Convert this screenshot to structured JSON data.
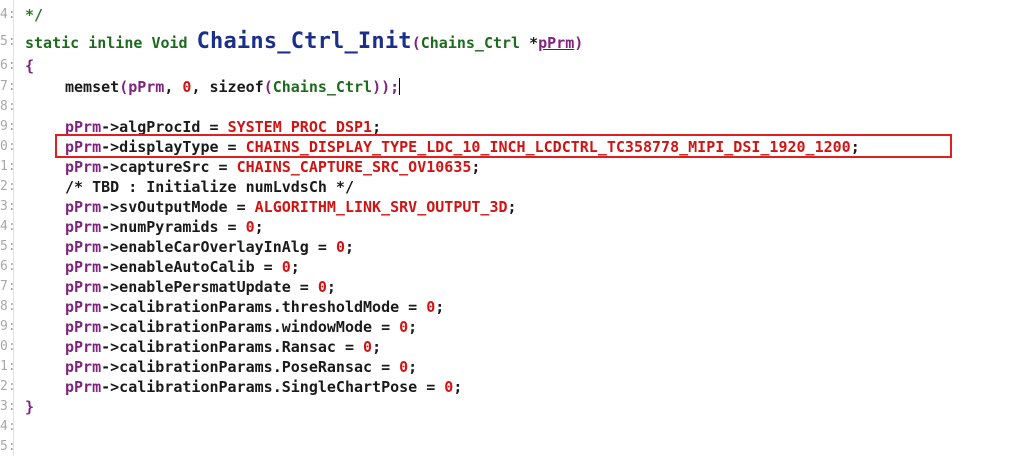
{
  "gutter": {
    "lines": [
      "4:",
      "5:",
      "6:",
      "7:",
      "8:",
      "9:",
      "0:",
      "1:",
      "2:",
      "3:",
      "4:",
      "5:",
      "6:",
      "7:",
      "8:",
      "9:",
      "0:",
      "1:",
      "2:",
      "3:",
      "4:",
      "5:"
    ]
  },
  "code": {
    "l0": {
      "t1": "*/"
    },
    "l1": {
      "k1": "static",
      "k2": "inline",
      "t1": "Void",
      "fn": "Chains_Ctrl_Init",
      "p1": "(",
      "t2": "Chains_Ctrl",
      "s1": " *",
      "v1": "pPrm",
      "p2": ")"
    },
    "l2": {
      "t1": "{"
    },
    "l3": {
      "fn": "memset",
      "p1": "(",
      "v1": "pPrm",
      "c1": ", ",
      "n1": "0",
      "c2": ", ",
      "f2": "sizeof",
      "p2": "(",
      "t1": "Chains_Ctrl",
      "p3": "));"
    },
    "l5": {
      "v1": "pPrm",
      "a": "->algProcId = ",
      "m": "SYSTEM_PROC_DSP1",
      "e": ";"
    },
    "l6": {
      "v1": "pPrm",
      "a": "->displayType = ",
      "m": "CHAINS_DISPLAY_TYPE_LDC_10_INCH_LCDCTRL_TC358778_MIPI_DSI_1920_1200",
      "e": ";"
    },
    "l7": {
      "v1": "pPrm",
      "a": "->captureSrc = ",
      "m": "CHAINS_CAPTURE_SRC_OV10635",
      "e": ";"
    },
    "l8": {
      "t1": "/* TBD : Initialize numLvdsCh */"
    },
    "l9": {
      "v1": "pPrm",
      "a": "->svOutputMode = ",
      "m": "ALGORITHM_LINK_SRV_OUTPUT_3D",
      "e": ";"
    },
    "l10": {
      "v1": "pPrm",
      "a": "->numPyramids = ",
      "n": "0",
      "e": ";"
    },
    "l11": {
      "v1": "pPrm",
      "a": "->enableCarOverlayInAlg = ",
      "n": "0",
      "e": ";"
    },
    "l12": {
      "v1": "pPrm",
      "a": "->enableAutoCalib = ",
      "n": "0",
      "e": ";"
    },
    "l13": {
      "v1": "pPrm",
      "a": "->enablePersmatUpdate = ",
      "n": "0",
      "e": ";"
    },
    "l14": {
      "v1": "pPrm",
      "a": "->calibrationParams.thresholdMode = ",
      "n": "0",
      "e": ";"
    },
    "l15": {
      "v1": "pPrm",
      "a": "->calibrationParams.windowMode = ",
      "n": "0",
      "e": ";"
    },
    "l16": {
      "v1": "pPrm",
      "a": "->calibrationParams.Ransac = ",
      "n": "0",
      "e": ";"
    },
    "l17": {
      "v1": "pPrm",
      "a": "->calibrationParams.PoseRansac = ",
      "n": "0",
      "e": ";"
    },
    "l18": {
      "v1": "pPrm",
      "a": "->calibrationParams.SingleChartPose = ",
      "n": "0",
      "e": ";"
    },
    "l19": {
      "t1": "}"
    }
  },
  "colors": {
    "highlight_border": "#e02020",
    "keyword": "#1e6a1e",
    "function_name": "#1c2f8a",
    "variable": "#7f237f",
    "macro": "#d01414"
  }
}
